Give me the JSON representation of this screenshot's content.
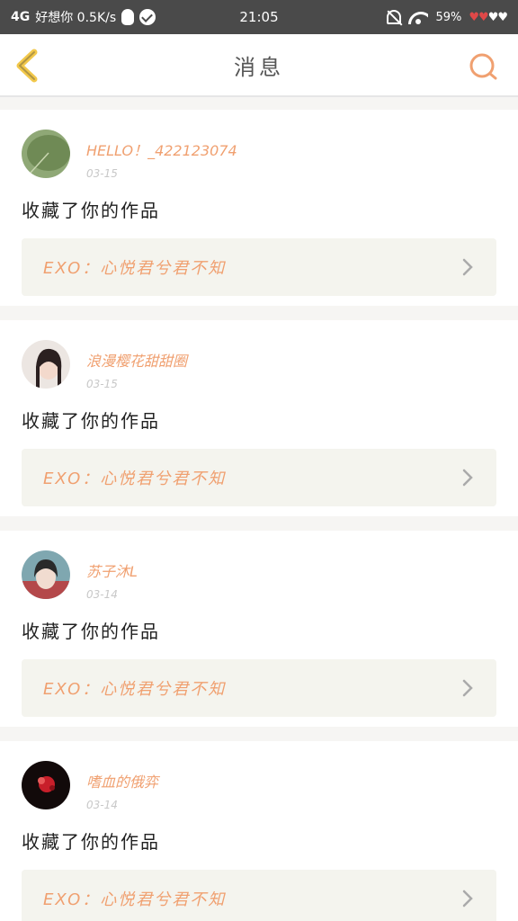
{
  "status": {
    "network": "4G",
    "carrier": "好想你 0.5K/s",
    "time": "21:05",
    "battery": "59%",
    "hearts": "♥♥",
    "hearts_white": "♥♥"
  },
  "nav": {
    "title": "消息"
  },
  "messages": [
    {
      "user": "HELLO！_422123074",
      "date": "03-15",
      "action": "收藏了你的作品",
      "work": "EXO：心悦君兮君不知",
      "avatar_color": "#6f8a55"
    },
    {
      "user": "浪漫樱花甜甜圈",
      "date": "03-15",
      "action": "收藏了你的作品",
      "work": "EXO：心悦君兮君不知",
      "avatar_color": "#d9c8c0"
    },
    {
      "user": "苏子沐L",
      "date": "03-14",
      "action": "收藏了你的作品",
      "work": "EXO：心悦君兮君不知",
      "avatar_color": "#6a8f9a"
    },
    {
      "user": "嗜血的俄弈",
      "date": "03-14",
      "action": "收藏了你的作品",
      "work": "EXO：心悦君兮君不知",
      "avatar_color": "#1a1010"
    }
  ],
  "colors": {
    "accent": "#f0a070",
    "back_arrow": "#f2c84b",
    "status_bar": "#4a4a4a"
  }
}
